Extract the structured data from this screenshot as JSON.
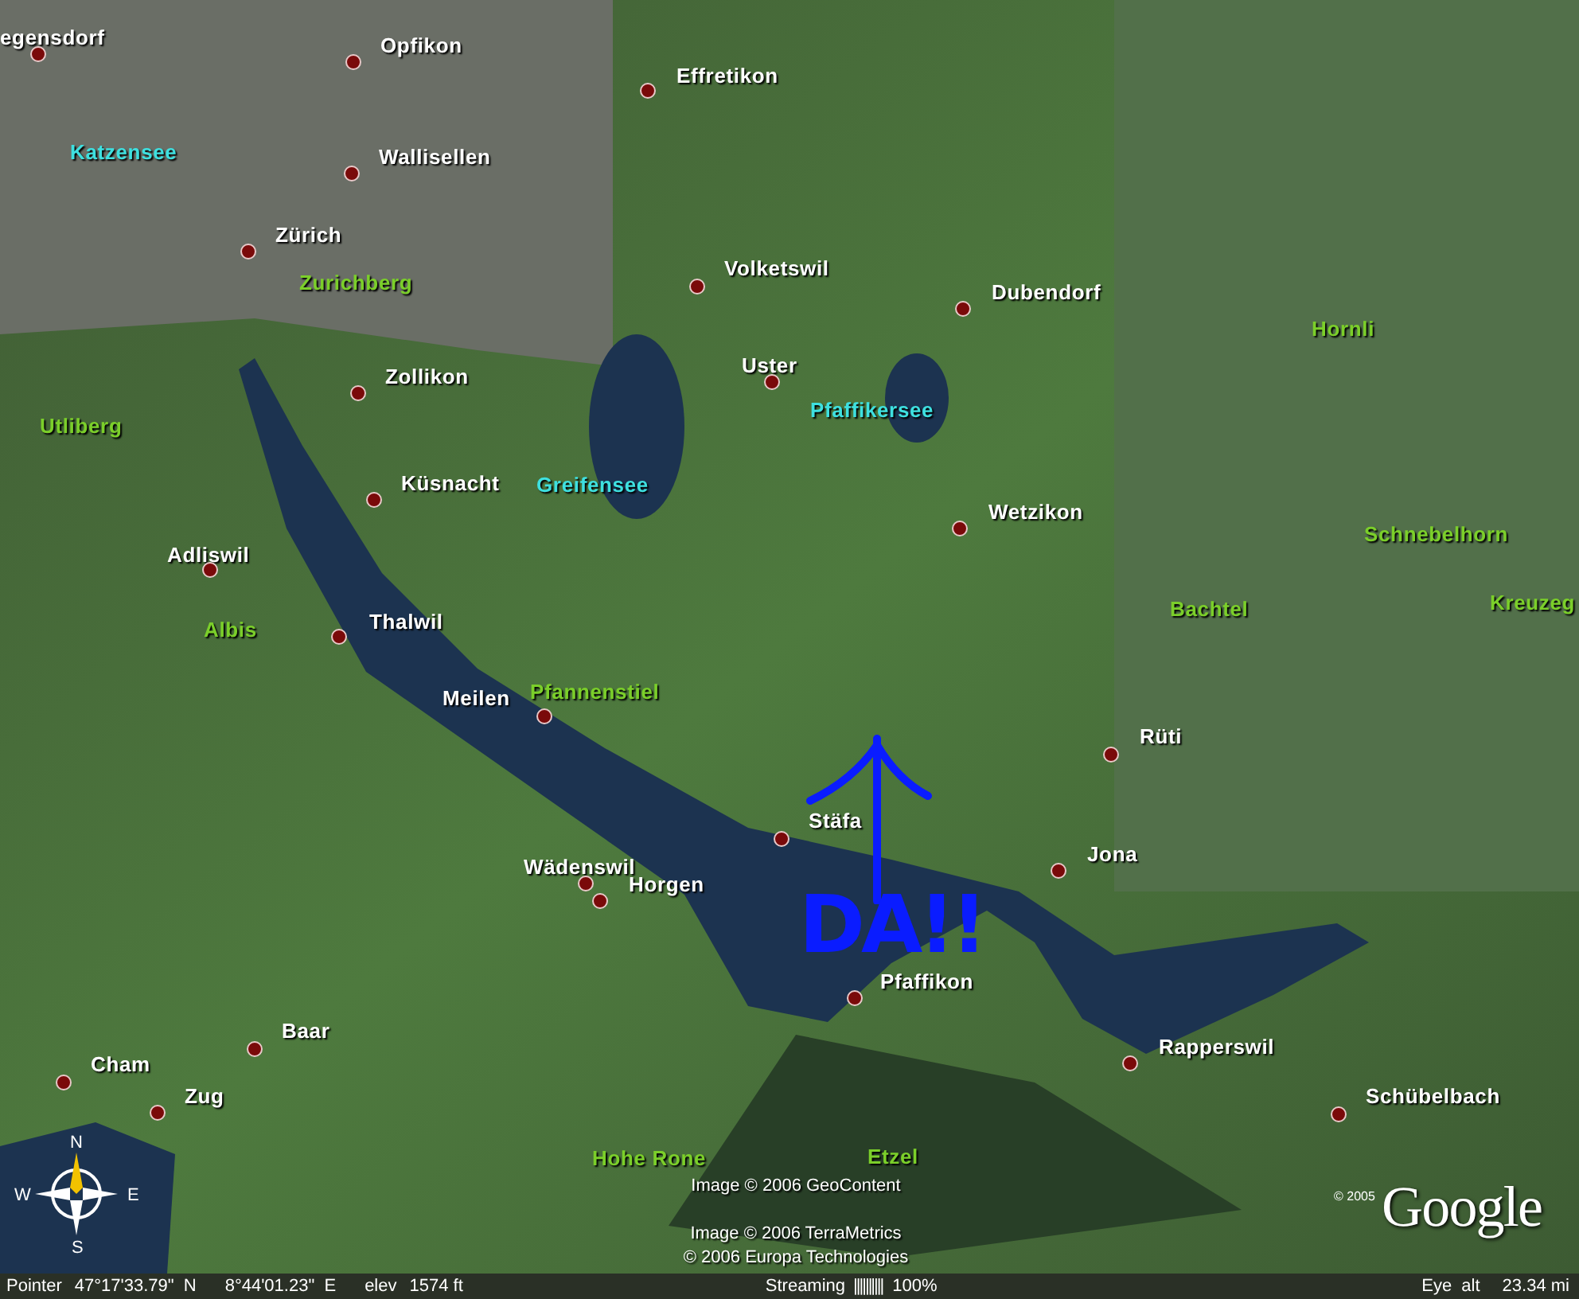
{
  "places": [
    {
      "name": "egensdorf",
      "kind": "town"
    },
    {
      "name": "Opfikon",
      "kind": "town"
    },
    {
      "name": "Effretikon",
      "kind": "town"
    },
    {
      "name": "Katzensee",
      "kind": "lake"
    },
    {
      "name": "Wallisellen",
      "kind": "town"
    },
    {
      "name": "Zürich",
      "kind": "town"
    },
    {
      "name": "Volketswil",
      "kind": "town"
    },
    {
      "name": "Zurichberg",
      "kind": "mountain"
    },
    {
      "name": "Dubendorf",
      "kind": "town"
    },
    {
      "name": "Hornli",
      "kind": "mountain"
    },
    {
      "name": "Uster",
      "kind": "town"
    },
    {
      "name": "Zollikon",
      "kind": "town"
    },
    {
      "name": "Pfaffikersee",
      "kind": "lake"
    },
    {
      "name": "Utliberg",
      "kind": "mountain"
    },
    {
      "name": "Küsnacht",
      "kind": "town"
    },
    {
      "name": "Greifensee",
      "kind": "lake"
    },
    {
      "name": "Wetzikon",
      "kind": "town"
    },
    {
      "name": "Schnebelhorn",
      "kind": "mountain"
    },
    {
      "name": "Adliswil",
      "kind": "town"
    },
    {
      "name": "Bachtel",
      "kind": "mountain"
    },
    {
      "name": "Kreuzeg",
      "kind": "mountain"
    },
    {
      "name": "Thalwil",
      "kind": "town"
    },
    {
      "name": "Albis",
      "kind": "mountain"
    },
    {
      "name": "Meilen",
      "kind": "town"
    },
    {
      "name": "Pfannenstiel",
      "kind": "mountain"
    },
    {
      "name": "Rüti",
      "kind": "town"
    },
    {
      "name": "Stäfa",
      "kind": "town"
    },
    {
      "name": "Jona",
      "kind": "town"
    },
    {
      "name": "Wädenswil",
      "kind": "town"
    },
    {
      "name": "Horgen",
      "kind": "town"
    },
    {
      "name": "Pfaffikon",
      "kind": "town"
    },
    {
      "name": "Baar",
      "kind": "town"
    },
    {
      "name": "Rapperswil",
      "kind": "town"
    },
    {
      "name": "Cham",
      "kind": "town"
    },
    {
      "name": "Zug",
      "kind": "town"
    },
    {
      "name": "Schübelbach",
      "kind": "town"
    },
    {
      "name": "Hohe Rone",
      "kind": "mountain"
    },
    {
      "name": "Etzel",
      "kind": "mountain"
    }
  ],
  "annotation": {
    "text": "DA!!"
  },
  "compass": {
    "n": "N",
    "s": "S",
    "e": "E",
    "w": "W"
  },
  "credits": [
    "Image © 2006 GeoContent",
    "Image © 2006 TerraMetrics",
    "© 2006 Europa Technologies"
  ],
  "logo": {
    "year": "© 2005",
    "text": "Google"
  },
  "status_bar": {
    "pointer_label": "Pointer",
    "latitude": "47°17'33.79\"  N",
    "longitude": "8°44'01.23\"  E",
    "elev_label": "elev",
    "elev": "1574 ft",
    "streaming_label": "Streaming",
    "streaming_meter": "||||||||||",
    "streaming_percent": "100%",
    "eye_alt_label": "Eye  alt",
    "eye_alt": "23.34 mi"
  }
}
